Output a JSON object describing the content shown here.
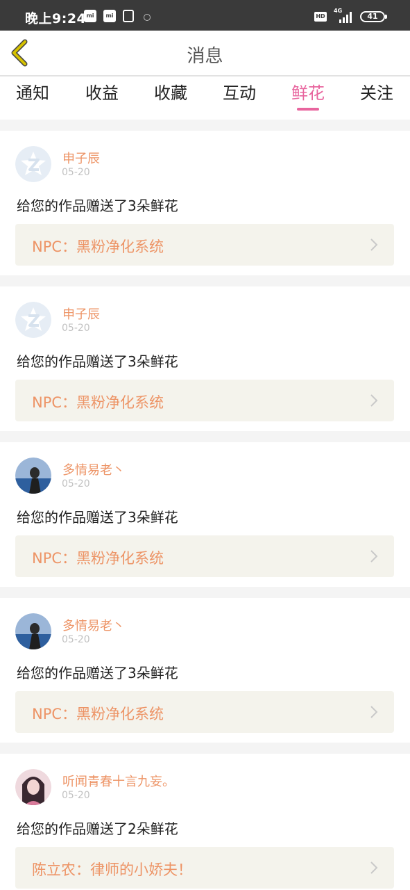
{
  "status_bar": {
    "time": "晚上9:24",
    "app_icon_label": "mi",
    "hd_label": "HD",
    "network_label": "4G",
    "battery": "41"
  },
  "header": {
    "title": "消息",
    "back_icon": "chevron-left-icon",
    "accent_color": "#e8659e",
    "back_icon_color": "#d6c200"
  },
  "tabs": [
    {
      "label": "通知",
      "active": false
    },
    {
      "label": "收益",
      "active": false
    },
    {
      "label": "收藏",
      "active": false
    },
    {
      "label": "互动",
      "active": false
    },
    {
      "label": "鲜花",
      "active": true
    },
    {
      "label": "关注",
      "active": false
    }
  ],
  "notifications": [
    {
      "user": "申子辰",
      "date": "05-20",
      "message": "给您的作品赠送了3朵鲜花",
      "work": "NPC：黑粉净化系统",
      "avatar": "qzone-default-avatar"
    },
    {
      "user": "申子辰",
      "date": "05-20",
      "message": "给您的作品赠送了3朵鲜花",
      "work": "NPC：黑粉净化系统",
      "avatar": "qzone-default-avatar"
    },
    {
      "user": "多情易老丶",
      "date": "05-20",
      "message": "给您的作品赠送了3朵鲜花",
      "work": "NPC：黑粉净化系统",
      "avatar": "photo-avatar-girl-blue"
    },
    {
      "user": "多情易老丶",
      "date": "05-20",
      "message": "给您的作品赠送了3朵鲜花",
      "work": "NPC：黑粉净化系统",
      "avatar": "photo-avatar-girl-blue"
    },
    {
      "user": "听闻青春十言九妄。",
      "date": "05-20",
      "message": "给您的作品赠送了2朵鲜花",
      "work": "陈立农：律师的小娇夫！",
      "avatar": "photo-avatar-girl-pink"
    }
  ]
}
